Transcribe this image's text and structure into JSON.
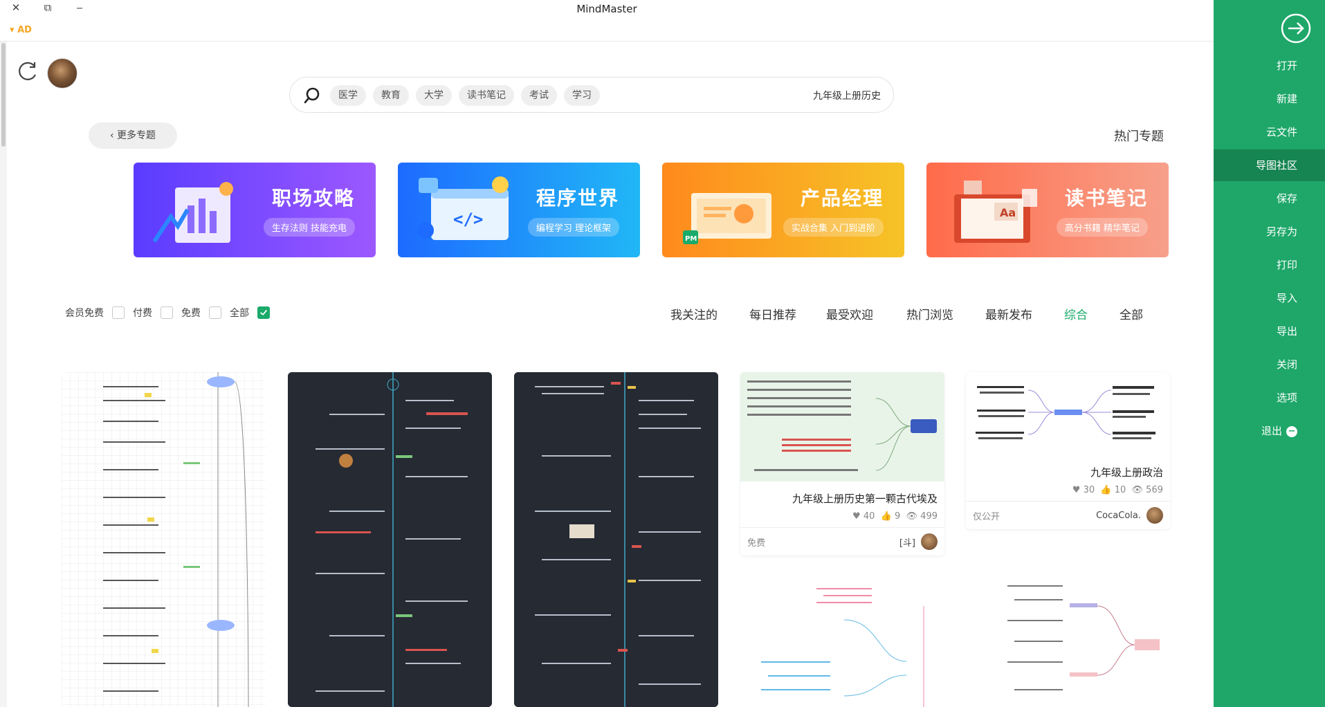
{
  "window": {
    "title": "MindMaster",
    "ad_label": "AD",
    "close_icon": "✕",
    "restore_icon": "⧉",
    "minimize_icon": "‒"
  },
  "search": {
    "value": "九年级上册历史",
    "tags": [
      "学习",
      "考试",
      "读书笔记",
      "大学",
      "教育",
      "医学"
    ]
  },
  "topics": {
    "title": "热门专题",
    "more_label": "更多专题"
  },
  "banners": [
    {
      "title": "读书笔记",
      "subtitle": "高分书籍 精华笔记",
      "color_from": "#f7a08a",
      "color_to": "#ff6b4a"
    },
    {
      "title": "产品经理",
      "subtitle": "实战合集 入门到进阶",
      "color_from": "#f6c327",
      "color_to": "#ff8a1d"
    },
    {
      "title": "程序世界",
      "subtitle": "编程学习 理论框架",
      "color_from": "#21b7f6",
      "color_to": "#1d6bff"
    },
    {
      "title": "职场攻略",
      "subtitle": "生存法则 技能充电",
      "color_from": "#9c58ff",
      "color_to": "#5a3cff"
    }
  ],
  "tabs": {
    "all": "全部",
    "composite": "综合",
    "latest": "最新发布",
    "hot_views": "热门浏览",
    "most_liked": "最受欢迎",
    "daily": "每日推荐",
    "following": "我关注的"
  },
  "filters": {
    "all": "全部",
    "free": "免费",
    "paid": "付费",
    "member_free": "会员免费"
  },
  "cards": [
    {
      "title": "九年级上册政治",
      "views": "569",
      "likes": "10",
      "favorites": "30",
      "author": "CocaCola.",
      "access": "仅公开"
    },
    {
      "title": "九年级上册历史第一颗古代埃及",
      "views": "499",
      "likes": "9",
      "favorites": "40",
      "author": "[斗]",
      "access": "免费"
    }
  ],
  "sidebar": {
    "items": [
      "打开",
      "新建",
      "云文件",
      "导图社区",
      "保存",
      "另存为",
      "打印",
      "导入",
      "导出",
      "关闭",
      "选项",
      "退出"
    ],
    "active": "导图社区"
  }
}
